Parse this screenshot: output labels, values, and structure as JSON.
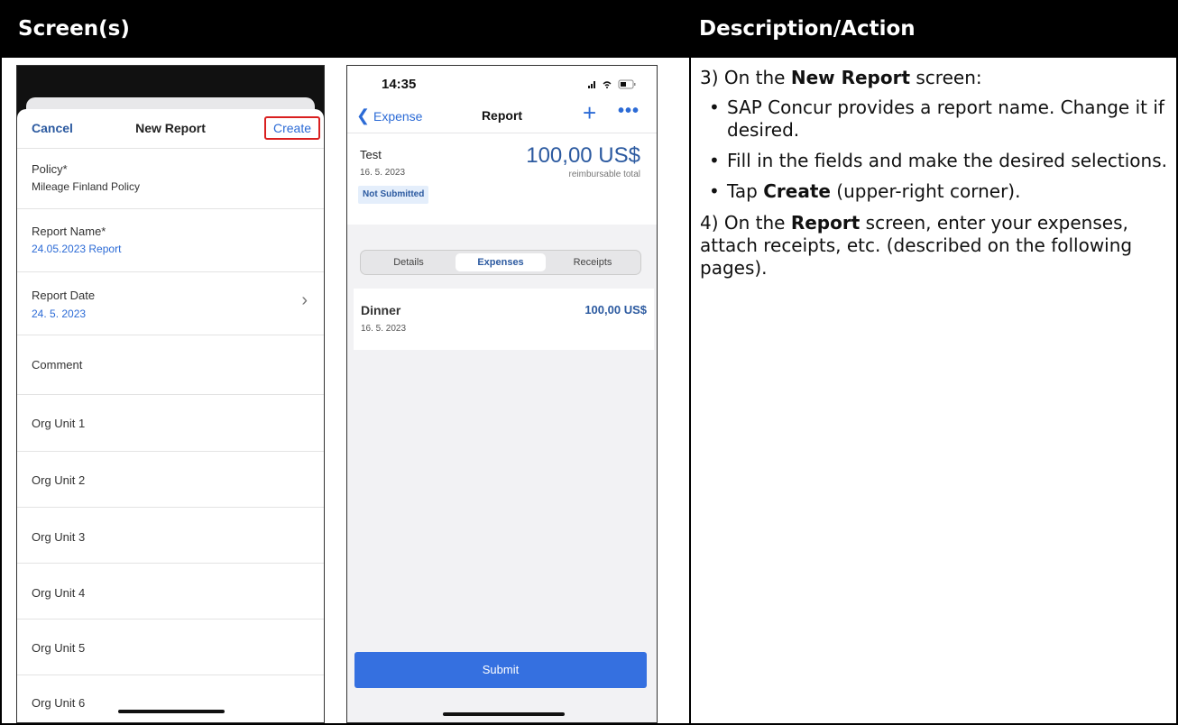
{
  "table": {
    "header_screens": "Screen(s)",
    "header_description": "Description/Action"
  },
  "new_report": {
    "cancel": "Cancel",
    "title": "New Report",
    "create": "Create",
    "policy_label": "Policy*",
    "policy_value": "Mileage Finland Policy",
    "name_label": "Report Name*",
    "name_value": "24.05.2023 Report",
    "date_label": "Report Date",
    "date_value": "24. 5. 2023",
    "chevron": "›",
    "comment": "Comment",
    "org_units": [
      "Org Unit 1",
      "Org Unit 2",
      "Org Unit 3",
      "Org Unit 4",
      "Org Unit 5",
      "Org Unit 6"
    ]
  },
  "report": {
    "time": "14:35",
    "status_icons": "signal-icon wifi-icon battery-icon",
    "back": "Expense",
    "title": "Report",
    "plus": "+",
    "more": "•••",
    "report_name": "Test",
    "report_date": "16. 5. 2023",
    "status_badge": "Not Submitted",
    "amount": "100,00 US$",
    "amount_label": "reimbursable total",
    "tabs": [
      "Details",
      "Expenses",
      "Receipts"
    ],
    "active_tab": "Expenses",
    "expense": {
      "name": "Dinner",
      "date": "16. 5. 2023",
      "amount": "100,00 US$"
    },
    "submit": "Submit"
  },
  "description": {
    "step3_prefix": "3) On the ",
    "step3_bold": "New Report",
    "step3_suffix": " screen:",
    "bullet1": "SAP Concur provides a report name. Change it if desired.",
    "bullet2": "Fill in the fields and make the desired selections.",
    "bullet3_prefix": "Tap ",
    "bullet3_bold": "Create",
    "bullet3_suffix": " (upper-right corner).",
    "step4_prefix": "4) On the ",
    "step4_bold": "Report",
    "step4_suffix": " screen, enter your expenses, attach receipts, etc. (described on the following pages)."
  }
}
